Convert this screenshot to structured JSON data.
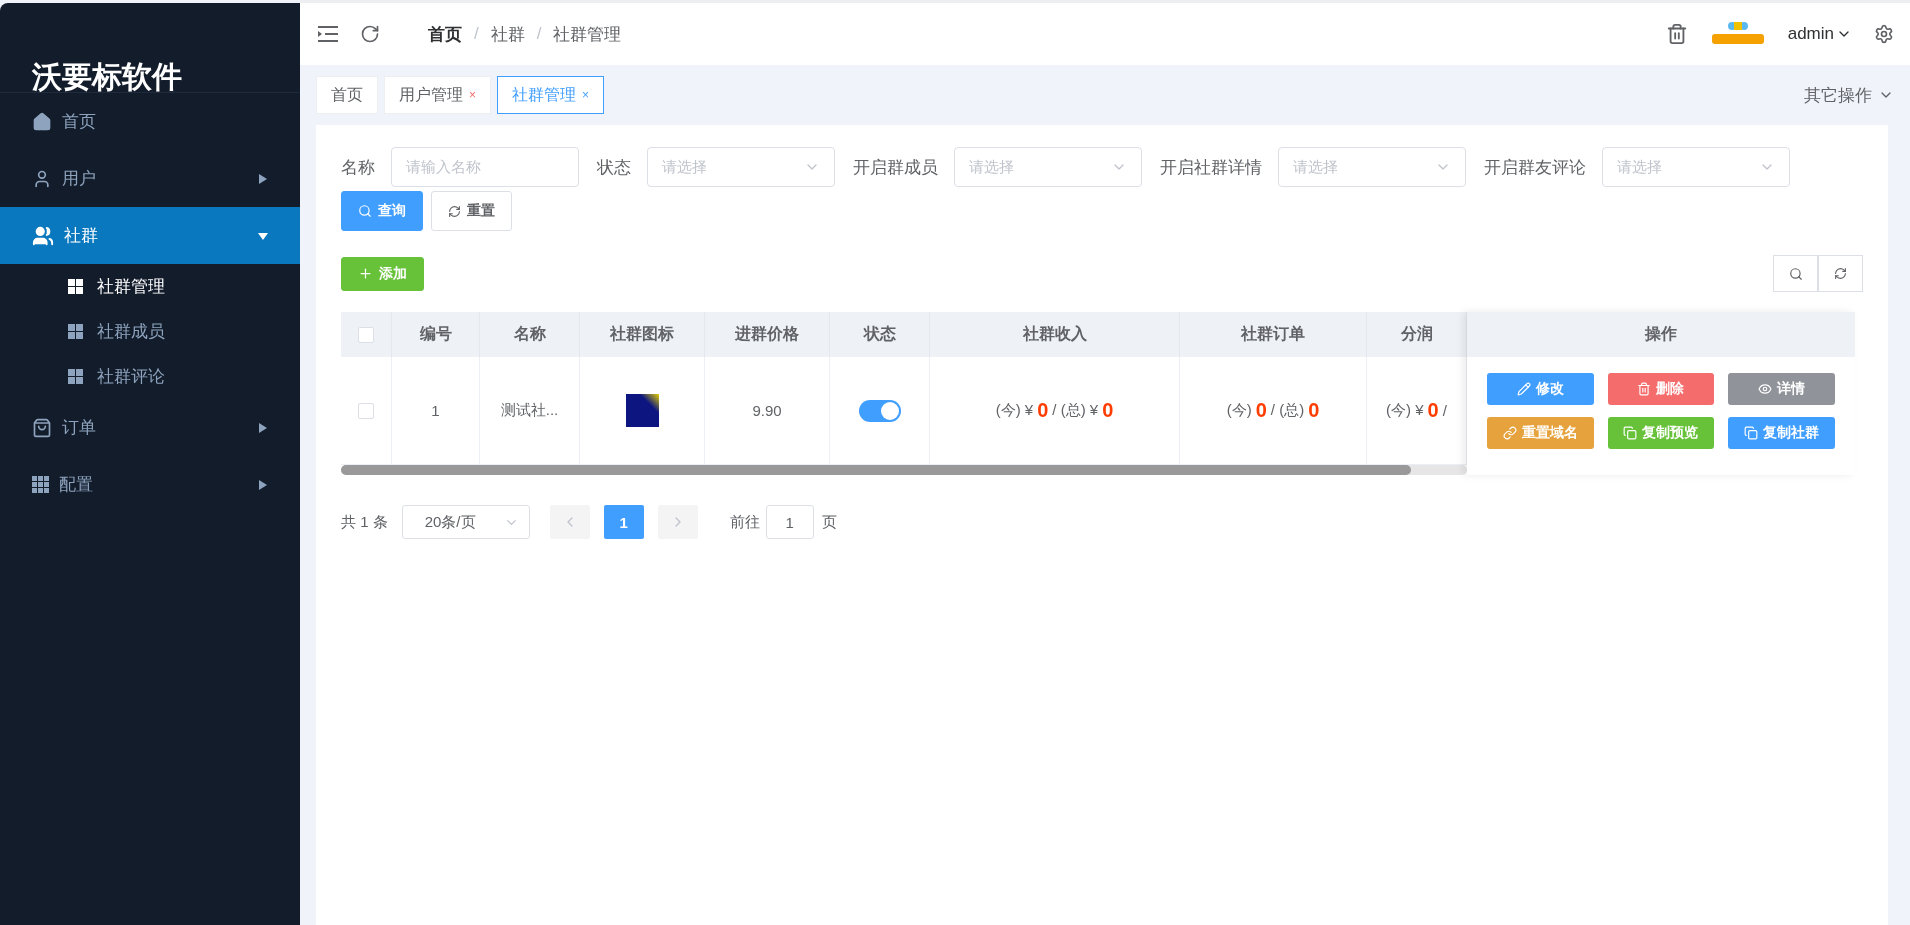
{
  "sidebar": {
    "title": "沃要标软件",
    "items": [
      {
        "label": "首页",
        "selected": false
      },
      {
        "label": "用户",
        "selected": false,
        "expanded": false
      },
      {
        "label": "社群",
        "selected": true,
        "expanded": true,
        "children": [
          {
            "label": "社群管理",
            "selected": true
          },
          {
            "label": "社群成员",
            "selected": false
          },
          {
            "label": "社群评论",
            "selected": false
          }
        ]
      },
      {
        "label": "订单",
        "selected": false,
        "expanded": false
      },
      {
        "label": "配置",
        "selected": false,
        "expanded": false
      }
    ]
  },
  "header": {
    "breadcrumb": [
      {
        "label": "首页",
        "bold": true
      },
      {
        "label": "社群",
        "bold": false
      },
      {
        "label": "社群管理",
        "bold": false
      }
    ],
    "separator": "/",
    "user": "admin"
  },
  "tabs": [
    {
      "label": "首页",
      "selected": false
    },
    {
      "label": "用户管理",
      "selected": false,
      "close_mark": "×"
    },
    {
      "label": "社群管理",
      "selected": true,
      "close_mark": "×"
    }
  ],
  "tabs_menu": "其它操作",
  "filters": [
    {
      "label": "名称",
      "kind": "input",
      "placeholder": "请输入名称"
    },
    {
      "label": "状态",
      "kind": "select",
      "placeholder": "请选择"
    },
    {
      "label": "开启群成员",
      "kind": "select",
      "placeholder": "请选择"
    },
    {
      "label": "开启社群详情",
      "kind": "select",
      "placeholder": "请选择"
    },
    {
      "label": "开启群友评论",
      "kind": "select",
      "placeholder": "请选择"
    }
  ],
  "filter_buttons": [
    {
      "label": "查询",
      "kind": "primary"
    },
    {
      "label": "重置",
      "kind": "plain"
    }
  ],
  "add_button": "添加",
  "table": {
    "header_checked": false,
    "columns": [
      "编号",
      "名称",
      "社群图标",
      "进群价格",
      "状态",
      "社群收入",
      "社群订单",
      "分润",
      "操作"
    ],
    "rows": [
      {
        "checked": false,
        "id": "1",
        "name": "测试社...",
        "price": "9.90",
        "on": true,
        "income": {
          "today_label": "(今)",
          "today_currency": "¥",
          "today": "0",
          "separator": "/",
          "total_label": "(总)",
          "total_currency": "¥",
          "total": "0"
        },
        "orders": {
          "today_label": "(今)",
          "today": "0",
          "separator": "/",
          "total_label": "(总)",
          "total": "0"
        },
        "share": {
          "today_label": "(今)",
          "today_currency": "¥",
          "today": "0",
          "separator": "/"
        },
        "actions": [
          {
            "label": "修改",
            "color": "#409eff"
          },
          {
            "label": "删除",
            "color": "#f56c6c"
          },
          {
            "label": "详情",
            "color": "#909399"
          },
          {
            "label": "重置域名",
            "color": "#e6a23c"
          },
          {
            "label": "复制预览",
            "color": "#67c23a"
          },
          {
            "label": "复制社群",
            "color": "#409eff"
          }
        ]
      }
    ]
  },
  "pagination": {
    "total": "共 1 条",
    "page_size": "20条/页",
    "pages": [
      {
        "label": "1",
        "selected": true
      }
    ],
    "goto_label": "前往",
    "goto_value": "1",
    "goto_suffix": "页"
  }
}
